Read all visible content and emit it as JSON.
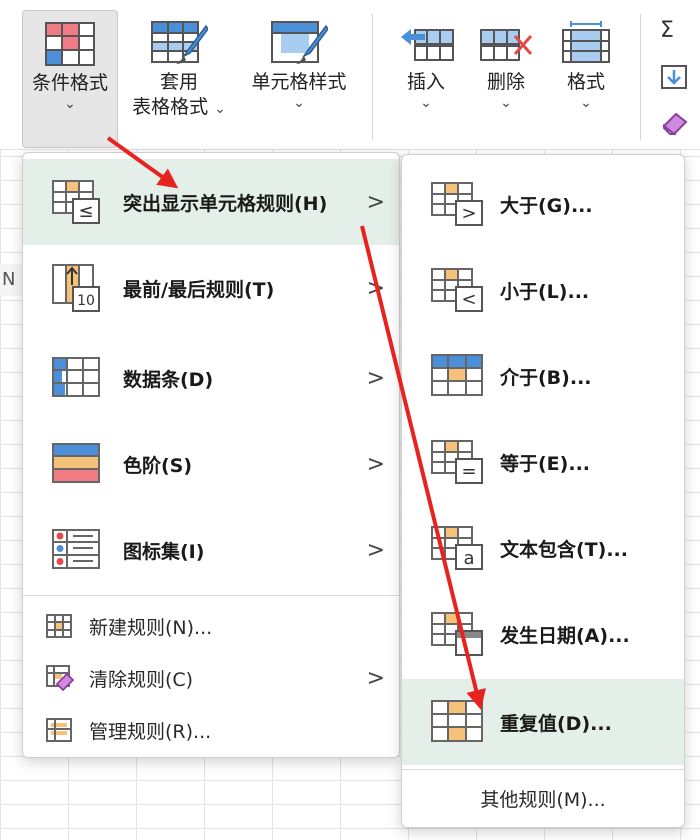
{
  "ribbon": {
    "buttons": [
      {
        "id": "conditional-format",
        "label": "条件格式",
        "chevron": "⌄",
        "icon": "conditional-format-icon"
      },
      {
        "id": "table-format",
        "label1": "套用",
        "label2": "表格格式",
        "chevron": "⌄",
        "icon": "table-format-icon"
      },
      {
        "id": "cell-style",
        "label": "单元格样式",
        "chevron": "⌄",
        "icon": "cell-style-icon"
      },
      {
        "id": "insert",
        "label": "插入",
        "chevron": "⌄",
        "icon": "insert-icon"
      },
      {
        "id": "delete",
        "label": "删除",
        "chevron": "⌄",
        "icon": "delete-icon"
      },
      {
        "id": "format",
        "label": "格式",
        "chevron": "⌄",
        "icon": "format-icon"
      }
    ],
    "right_icons": [
      "sum-icon",
      "fill-down-icon",
      "eraser-icon"
    ],
    "sum_glyph": "Σ"
  },
  "sheet": {
    "col_header": "N"
  },
  "main_menu": {
    "items": [
      {
        "label": "突出显示单元格规则(H)",
        "arrow": ">",
        "icon": "highlight-cells-rules-icon",
        "highlighted": true
      },
      {
        "label": "最前/最后规则(T)",
        "arrow": ">",
        "icon": "top-bottom-rules-icon"
      },
      {
        "label": "数据条(D)",
        "arrow": ">",
        "icon": "data-bars-icon"
      },
      {
        "label": "色阶(S)",
        "arrow": ">",
        "icon": "color-scales-icon"
      },
      {
        "label": "图标集(I)",
        "arrow": ">",
        "icon": "icon-sets-icon"
      }
    ],
    "small_items": [
      {
        "label": "新建规则(N)...",
        "icon": "new-rule-icon"
      },
      {
        "label": "清除规则(C)",
        "arrow": ">",
        "icon": "clear-rules-icon"
      },
      {
        "label": "管理规则(R)...",
        "icon": "manage-rules-icon"
      }
    ]
  },
  "sub_menu": {
    "items": [
      {
        "label": "大于(G)...",
        "icon": "greater-than-icon"
      },
      {
        "label": "小于(L)...",
        "icon": "less-than-icon"
      },
      {
        "label": "介于(B)...",
        "icon": "between-icon"
      },
      {
        "label": "等于(E)...",
        "icon": "equal-to-icon"
      },
      {
        "label": "文本包含(T)...",
        "icon": "text-contains-icon"
      },
      {
        "label": "发生日期(A)...",
        "icon": "date-occurring-icon"
      },
      {
        "label": "重复值(D)...",
        "icon": "duplicate-values-icon",
        "highlighted": true
      }
    ],
    "other": "其他规则(M)..."
  },
  "colors": {
    "accent_orange": "#f6c27a",
    "accent_blue": "#4a8fd8",
    "accent_red": "#f07b84",
    "highlight_bg": "#e5efe9",
    "annotation_red": "#e8231f"
  }
}
